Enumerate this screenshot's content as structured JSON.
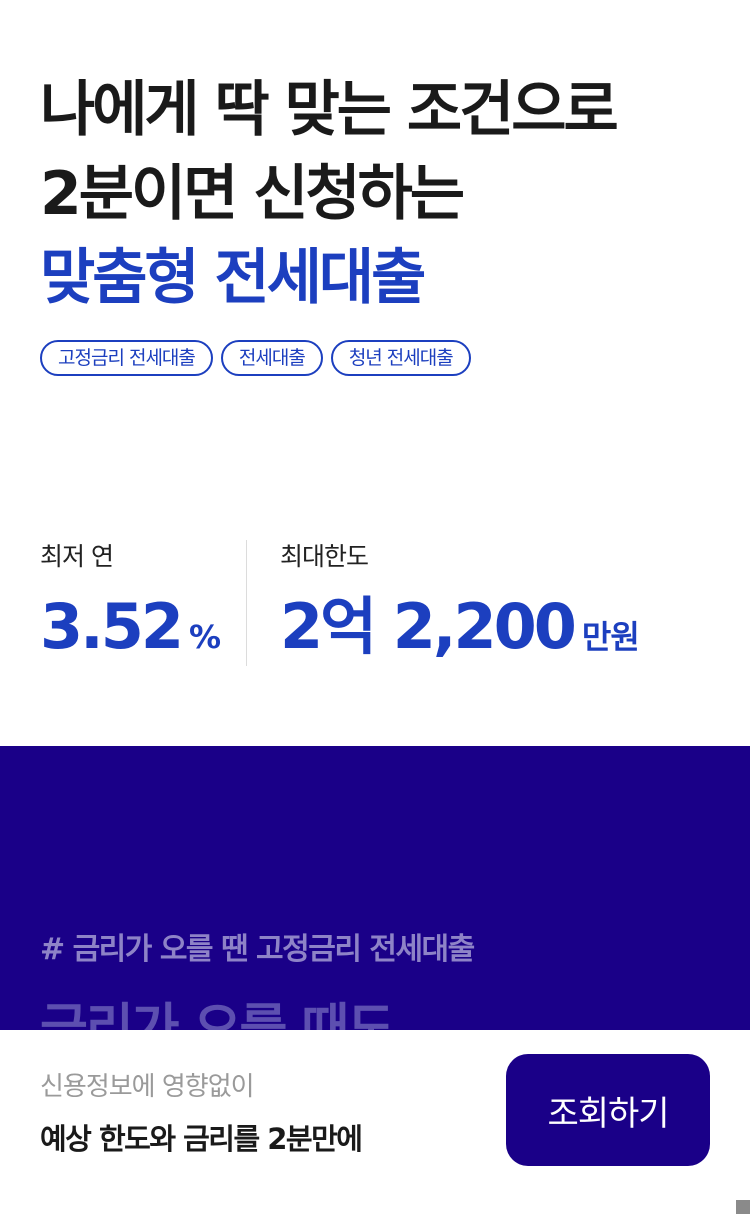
{
  "hero": {
    "line1": "나에게 딱 맞는 조건으로",
    "line2": "2분이면 신청하는",
    "line3": "맞춤형 전세대출"
  },
  "chips": [
    "고정금리 전세대출",
    "전세대출",
    "청년 전세대출"
  ],
  "stats": {
    "rate": {
      "label": "최저 연",
      "value": "3.52",
      "unit": "%"
    },
    "limit": {
      "label": "최대한도",
      "value": "2억 2,200",
      "unit": "만원"
    }
  },
  "promo": {
    "tag": "# 금리가 오를 땐 고정금리 전세대출",
    "headline": "금리가 오를 때도"
  },
  "cta": {
    "sub": "신용정보에 영향없이",
    "main": "예상 한도와 금리를 2분만에",
    "button": "조회하기"
  },
  "colors": {
    "accent": "#1c3fbf",
    "brand_navy": "#1a0088",
    "muted_text": "#9a9a9a"
  }
}
